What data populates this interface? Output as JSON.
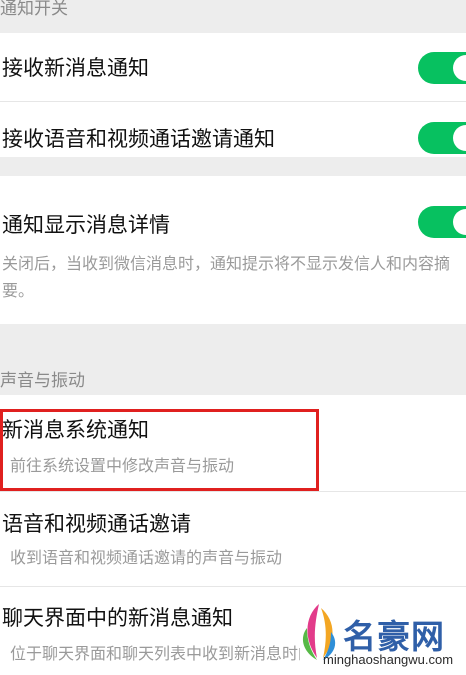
{
  "sections": {
    "notification_switch": {
      "header": "通知开关"
    },
    "sound_vibration": {
      "header": "声音与振动"
    }
  },
  "settings": {
    "receive_new_message": {
      "label": "接收新消息通知",
      "enabled": true
    },
    "receive_call_invite": {
      "label": "接收语音和视频通话邀请通知",
      "enabled": true
    },
    "show_message_detail": {
      "label": "通知显示消息详情",
      "enabled": true,
      "description": "关闭后，当收到微信消息时，通知提示将不显示发信人和内容摘要。"
    },
    "new_message_system_notification": {
      "label": "新消息系统通知",
      "description": "前往系统设置中修改声音与振动"
    },
    "voice_video_call_invite": {
      "label": "语音和视频通话邀请",
      "description": "收到语音和视频通话邀请的声音与振动"
    },
    "chat_new_message": {
      "label": "聊天界面中的新消息通知",
      "description": "位于聊天界面和聊天列表中收到新消息时的声音与振动"
    }
  },
  "watermark": {
    "brand": "名豪网",
    "url": "minghaoshangwu.com"
  },
  "colors": {
    "toggle_on": "#07c160",
    "highlight": "#e0201f",
    "background": "#ededed"
  }
}
